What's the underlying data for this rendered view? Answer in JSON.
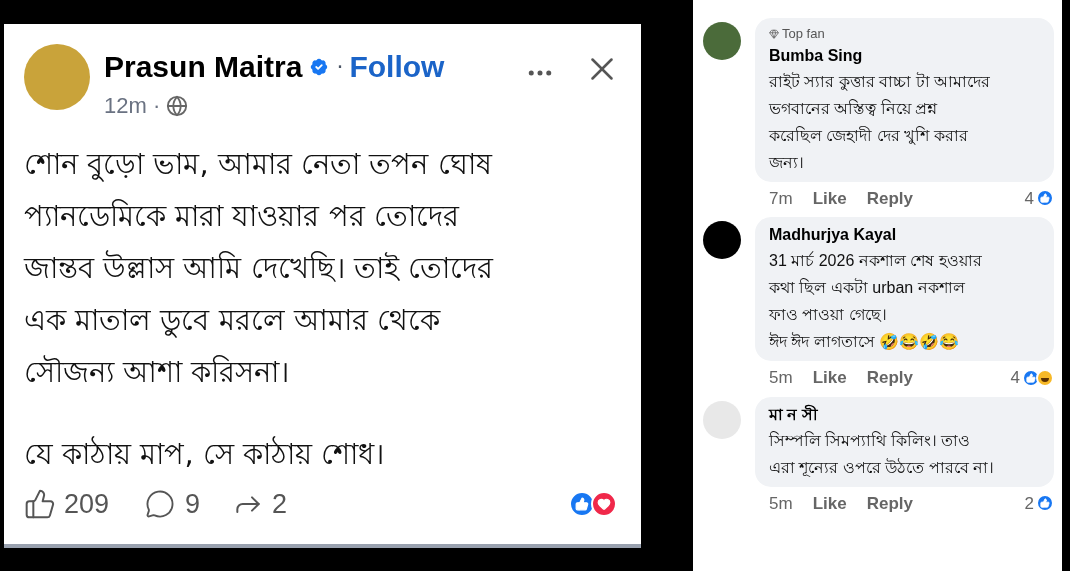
{
  "post": {
    "author": "Prasun Maitra",
    "separator": "·",
    "follow": "Follow",
    "time": "12m ·",
    "paragraphs": [
      [
        "শোন বুড়ো ভাম, আমার নেতা তপন ঘোষ",
        "প্যানডেমিকে মারা যাওয়ার পর তোদের",
        "জান্তব উল্লাস আমি দেখেছি। তাই তোদের",
        "এক মাতাল ডুবে মরলে আমার থেকে",
        "সৌজন্য আশা করিসনা।"
      ],
      [
        "যে কাঠায় মাপ, সে কাঠায় শোধ।"
      ]
    ],
    "likes": "209",
    "comments": "9",
    "shares": "2",
    "reactions": [
      {
        "kind": "like"
      },
      {
        "kind": "love"
      }
    ]
  },
  "comments": [
    {
      "badge": "Top fan",
      "name": "Bumba Sing",
      "lines": [
        "রাইট স্যার কুত্তার বাচ্চা টা আমাদের",
        "ভগবানের অস্তিত্ব নিয়ে প্রশ্ন",
        "করেছিল জেহাদী দের খুশি করার",
        "জন্য।"
      ],
      "time": "7m",
      "like": "Like",
      "reply": "Reply",
      "count": "4",
      "reactions": [
        {
          "kind": "like"
        }
      ]
    },
    {
      "name": "Madhurjya Kayal",
      "lines": [
        "31 মার্চ 2026 নকশাল শেষ হওয়ার",
        "কথা ছিল একটা urban নকশাল",
        "ফাও পাওয়া গেছে।",
        "ঈদ ঈদ লাগতাসে 🤣😂🤣😂"
      ],
      "time": "5m",
      "like": "Like",
      "reply": "Reply",
      "count": "4",
      "reactions": [
        {
          "kind": "like"
        },
        {
          "kind": "haha"
        }
      ]
    },
    {
      "name": "মা ন সী",
      "lines": [
        "সিম্পলি সিমপ্যাথি কিলিং। তাও",
        "এরা শূন্যের ওপরে উঠতে পারবে না।"
      ],
      "time": "5m",
      "like": "Like",
      "reply": "Reply",
      "count": "2",
      "reactions": [
        {
          "kind": "like"
        }
      ]
    }
  ]
}
